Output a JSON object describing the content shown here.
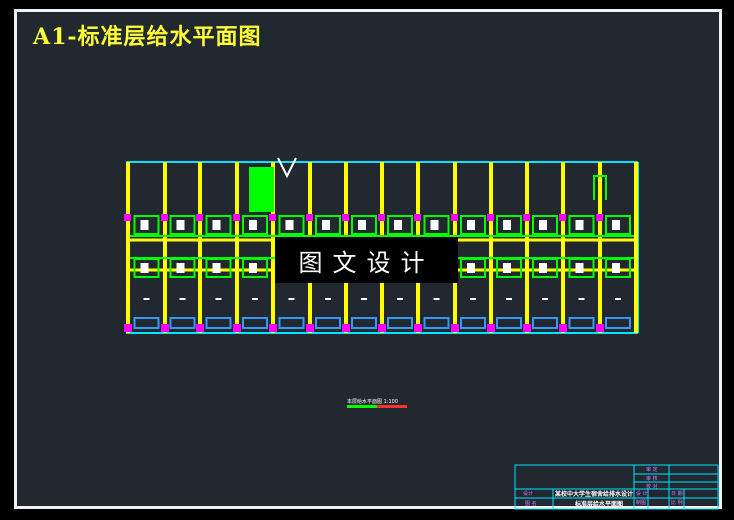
{
  "drawing": {
    "title": "A1-标准层给水平面图",
    "watermark": "图文设计",
    "legend_text": "本层给水平面图 1:100",
    "title_block": {
      "project": "某校中大学生宿舍给排水设计",
      "drawing_name": "标准层给水平面图",
      "label_left": "设计",
      "label_left2": "图 名",
      "cells": [
        "审 定",
        "审 核",
        "校 对",
        "设 计",
        "制图",
        "日 期",
        "比 例"
      ]
    }
  },
  "colors": {
    "background": "#212830",
    "column": "#ffff00",
    "wall": "#00e5ff",
    "pipe": "#00ff00",
    "fixture": "#ff00ff",
    "title": "#ffff33"
  }
}
